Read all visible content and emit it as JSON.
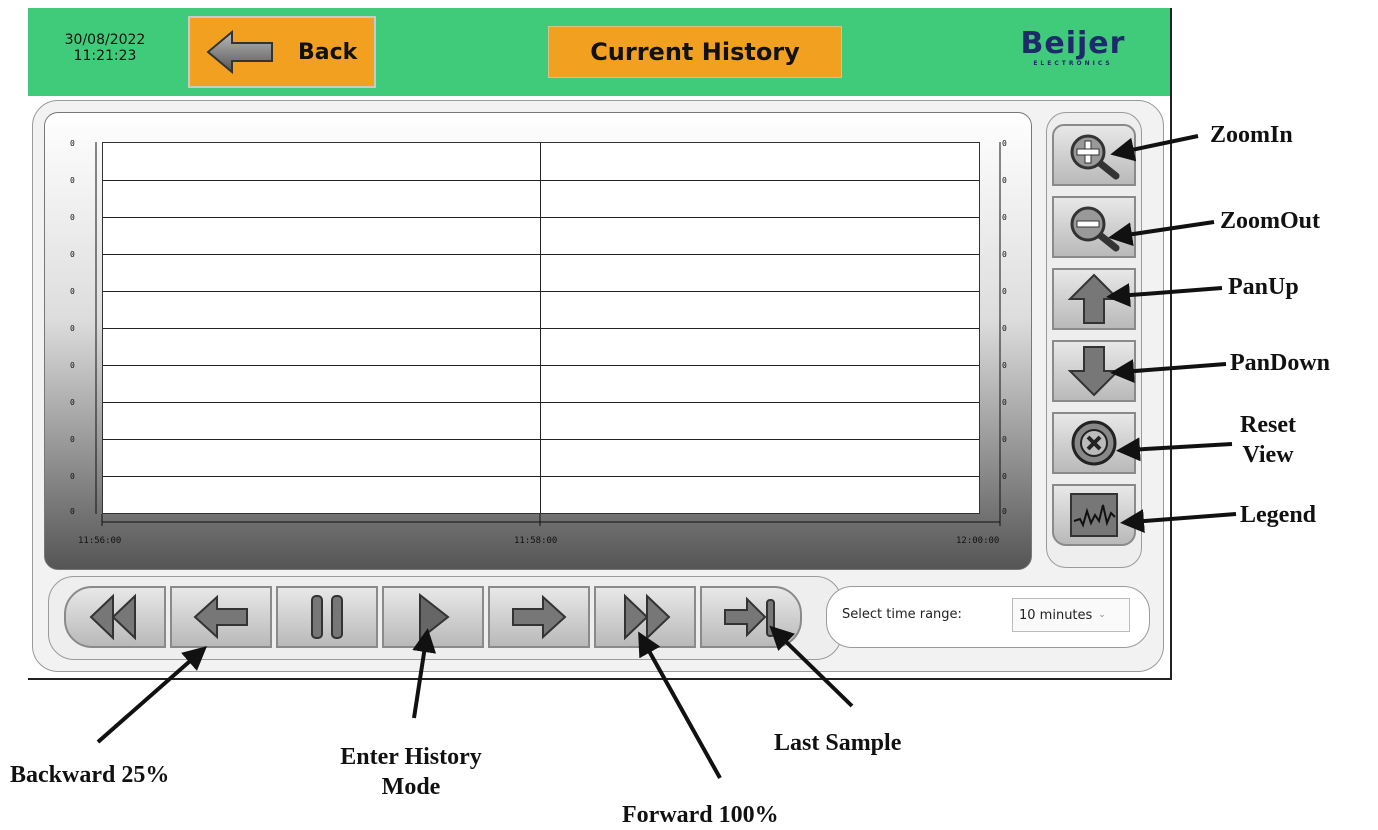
{
  "header": {
    "date": "30/08/2022",
    "time": "11:21:23",
    "back_label": "Back",
    "title": "Current History",
    "brand": "Beijer",
    "brand_sub": "ELECTRONICS",
    "header_color": "#3fcb7a",
    "accent_color": "#f2a020"
  },
  "chart": {
    "y_ticks_left": [
      "0",
      "0",
      "0",
      "0",
      "0",
      "0",
      "0",
      "0",
      "0",
      "0",
      "0"
    ],
    "y_ticks_right": [
      "0",
      "0",
      "0",
      "0",
      "0",
      "0",
      "0",
      "0",
      "0",
      "0",
      "0"
    ],
    "x_ticks": [
      "11:56:00",
      "11:58:00",
      "12:00:00"
    ]
  },
  "side_buttons": [
    {
      "name": "zoom-in-button",
      "icon": "zoom-in-icon"
    },
    {
      "name": "zoom-out-button",
      "icon": "zoom-out-icon"
    },
    {
      "name": "pan-up-button",
      "icon": "arrow-up-icon"
    },
    {
      "name": "pan-down-button",
      "icon": "arrow-down-icon"
    },
    {
      "name": "reset-view-button",
      "icon": "reset-x-icon"
    },
    {
      "name": "legend-button",
      "icon": "waveform-icon"
    }
  ],
  "nav_buttons": [
    {
      "name": "backward-100-button",
      "icon": "double-left-icon"
    },
    {
      "name": "backward-25-button",
      "icon": "arrow-left-icon"
    },
    {
      "name": "pause-button",
      "icon": "pause-icon"
    },
    {
      "name": "enter-history-button",
      "icon": "play-icon"
    },
    {
      "name": "forward-25-button",
      "icon": "arrow-right-icon"
    },
    {
      "name": "forward-100-button",
      "icon": "double-right-icon"
    },
    {
      "name": "last-sample-button",
      "icon": "arrow-to-end-icon"
    }
  ],
  "time_range": {
    "label": "Select time range:",
    "value": "10 minutes"
  },
  "annotations": {
    "zoom_in": "ZoomIn",
    "zoom_out": "ZoomOut",
    "pan_up": "PanUp",
    "pan_down": "PanDown",
    "reset_line1": "Reset",
    "reset_line2": "View",
    "legend": "Legend",
    "backward": "Backward 25%",
    "enter_line1": "Enter History",
    "enter_line2": "Mode",
    "last_sample": "Last Sample",
    "forward": "Forward 100%"
  }
}
